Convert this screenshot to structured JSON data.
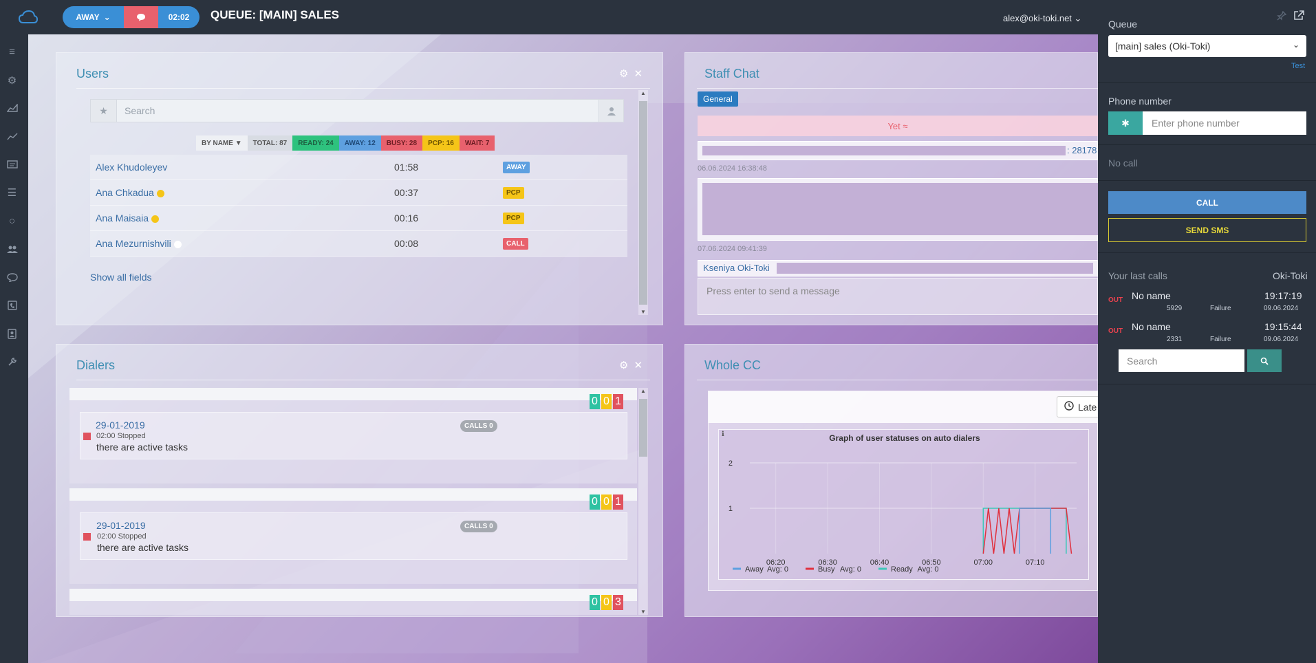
{
  "header": {
    "status_label": "AWAY",
    "timer": "02:02",
    "queue_title": "QUEUE: [MAIN] SALES",
    "user_email": "alex@oki-toki.net"
  },
  "sidebar": {
    "icons": [
      "menu-icon",
      "gear-icon",
      "chart-area-icon",
      "chart-line-icon",
      "id-card-icon",
      "list-icon",
      "circle-icon",
      "users-icon",
      "chat-icon",
      "phone-book-icon",
      "contacts-icon",
      "wrench-icon"
    ]
  },
  "users_panel": {
    "title": "Users",
    "search_placeholder": "Search",
    "filters": {
      "by_name": "BY NAME ▼",
      "total": "TOTAL: 87",
      "ready": "READY: 24",
      "away": "AWAY: 12",
      "busy": "BUSY: 28",
      "pcp": "PCP: 16",
      "wait": "WAIT: 7"
    },
    "rows": [
      {
        "name": "Alex Khudoleyev",
        "time": "01:58",
        "status": "AWAY",
        "status_color": "#5ea0e0",
        "dot": ""
      },
      {
        "name": "Ana Chkadua",
        "time": "00:37",
        "status": "PCP",
        "status_color": "#f5c518",
        "dot": "#f5c518"
      },
      {
        "name": "Ana Maisaia",
        "time": "00:16",
        "status": "PCP",
        "status_color": "#f5c518",
        "dot": "#f5c518"
      },
      {
        "name": "Ana Mezurnishvili",
        "time": "00:08",
        "status": "CALL",
        "status_color": "#e8616d",
        "dot": "#ffffff"
      }
    ],
    "show_all": "Show all fields"
  },
  "staff_chat": {
    "title": "Staff Chat",
    "channel_tab": "General",
    "yet_label": "Yet ≈",
    "msg1_suffix": ": 28178",
    "msg1_time": "06.06.2024 16:38:48",
    "msg2_time": "07.06.2024 09:41:39",
    "msg3_author": "Kseniya Oki-Toki",
    "input_placeholder": "Press enter to send a message"
  },
  "dialers": {
    "title": "Dialers",
    "items": [
      {
        "counts": [
          "0",
          "0",
          "1"
        ],
        "date": "29-01-2019",
        "sub": "02:00 Stopped",
        "text": "there are active tasks",
        "calls": "CALLS 0"
      },
      {
        "counts": [
          "0",
          "0",
          "1"
        ],
        "date": "29-01-2019",
        "sub": "02:00 Stopped",
        "text": "there are active tasks",
        "calls": "CALLS 0"
      },
      {
        "counts": [
          "0",
          "0",
          "3"
        ],
        "date": "",
        "sub": "",
        "text": "",
        "calls": ""
      }
    ]
  },
  "whole_cc": {
    "title": "Whole CC",
    "latest_button": "Late"
  },
  "chart_data": {
    "type": "line",
    "title": "Graph of user statuses on auto dialers",
    "x_ticks": [
      "06:20",
      "06:30",
      "06:40",
      "06:50",
      "07:00",
      "07:10"
    ],
    "y_ticks": [
      "1",
      "2"
    ],
    "ylim": [
      0,
      2
    ],
    "legend": [
      {
        "name": "Away",
        "avg": "Avg: 0",
        "color": "#5ea0e0"
      },
      {
        "name": "Busy",
        "avg": "Avg: 0",
        "color": "#e0303e"
      },
      {
        "name": "Ready",
        "avg": "Avg: 0",
        "color": "#3cc7b8"
      }
    ],
    "series": [
      {
        "name": "Ready",
        "x": [
          "07:00",
          "07:00",
          "07:02",
          "07:02",
          "07:16",
          "07:16"
        ],
        "values": [
          0,
          1,
          1,
          1,
          1,
          0
        ]
      },
      {
        "name": "Busy",
        "x": [
          "07:00",
          "07:01",
          "07:02",
          "07:03",
          "07:04",
          "07:05",
          "07:06",
          "07:07",
          "07:16",
          "07:17"
        ],
        "values": [
          0,
          1,
          0,
          1,
          0,
          1,
          0,
          1,
          1,
          0
        ]
      },
      {
        "name": "Away",
        "x": [
          "07:07",
          "07:07",
          "07:13",
          "07:13"
        ],
        "values": [
          0,
          1,
          1,
          0
        ]
      }
    ]
  },
  "right_panel": {
    "queue_label": "Queue",
    "queue_value": "[main] sales (Oki-Toki)",
    "test_link": "Test",
    "phone_label": "Phone number",
    "phone_placeholder": "Enter phone number",
    "no_call": "No call",
    "call_button": "CALL",
    "sms_button": "SEND SMS",
    "last_calls_label": "Your last calls",
    "last_calls_source": "Oki-Toki",
    "calls": [
      {
        "dir": "OUT",
        "name": "No name",
        "num": "5929",
        "result": "Failure",
        "time": "19:17:19",
        "date": "09.06.2024"
      },
      {
        "dir": "OUT",
        "name": "No name",
        "num": "2331",
        "result": "Failure",
        "time": "19:15:44",
        "date": "09.06.2024"
      }
    ],
    "search_placeholder": "Search"
  },
  "colors": {
    "accent": "#3a8fd6",
    "topbar": "#2b333e",
    "ready": "#2ec27e",
    "busy": "#e8616d",
    "pcp": "#f5c518"
  }
}
